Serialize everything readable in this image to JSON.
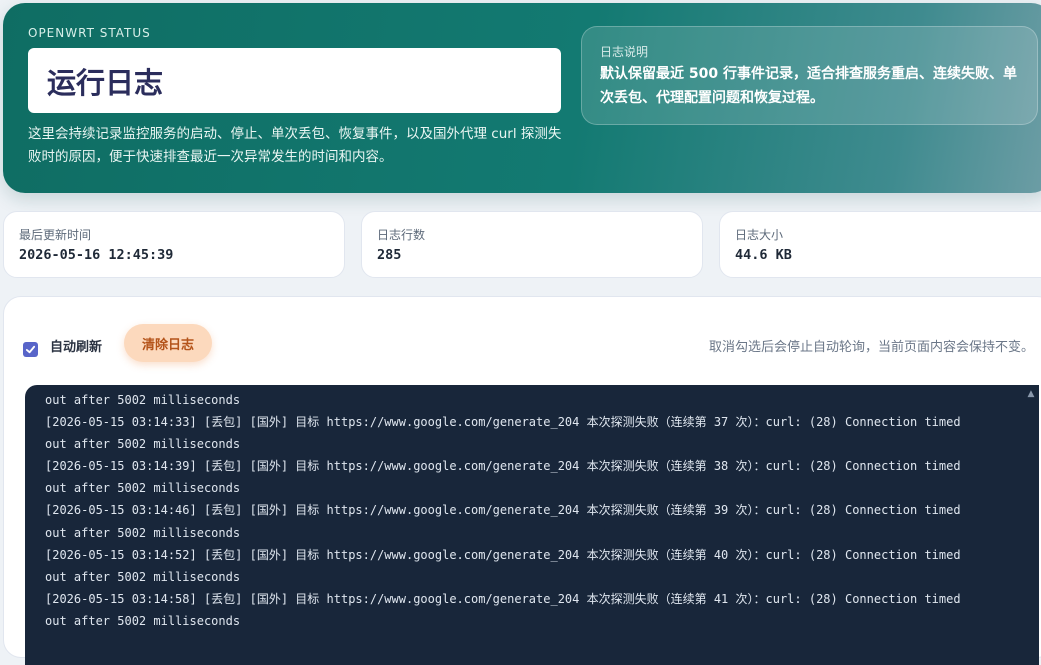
{
  "hero": {
    "eyebrow": "OPENWRT STATUS",
    "title": "运行日志",
    "description": "这里会持续记录监控服务的启动、停止、单次丢包、恢复事件，以及国外代理 curl 探测失败时的原因，便于快速排查最近一次异常发生的时间和内容。",
    "note_title": "日志说明",
    "note_body": "默认保留最近 500 行事件记录，适合排查服务重启、连续失败、单次丢包、代理配置问题和恢复过程。"
  },
  "stats": [
    {
      "label": "最后更新时间",
      "value": "2026-05-16 12:45:39"
    },
    {
      "label": "日志行数",
      "value": "285"
    },
    {
      "label": "日志大小",
      "value": "44.6 KB"
    }
  ],
  "controls": {
    "auto_refresh_label": "自动刷新",
    "auto_refresh_checked": true,
    "clear_button_label": "清除日志",
    "hint": "取消勾选后会停止自动轮询，当前页面内容会保持不变。"
  },
  "log_lines": [
    "out after 5002 milliseconds",
    "[2026-05-15 03:14:33] [丢包] [国外] 目标 https://www.google.com/generate_204 本次探测失败（连续第 37 次）：curl: (28) Connection timed",
    "out after 5002 milliseconds",
    "[2026-05-15 03:14:39] [丢包] [国外] 目标 https://www.google.com/generate_204 本次探测失败（连续第 38 次）：curl: (28) Connection timed",
    "out after 5002 milliseconds",
    "[2026-05-15 03:14:46] [丢包] [国外] 目标 https://www.google.com/generate_204 本次探测失败（连续第 39 次）：curl: (28) Connection timed",
    "out after 5002 milliseconds",
    "[2026-05-15 03:14:52] [丢包] [国外] 目标 https://www.google.com/generate_204 本次探测失败（连续第 40 次）：curl: (28) Connection timed",
    "out after 5002 milliseconds",
    "[2026-05-15 03:14:58] [丢包] [国外] 目标 https://www.google.com/generate_204 本次探测失败（连续第 41 次）：curl: (28) Connection timed",
    "out after 5002 milliseconds"
  ],
  "colors": {
    "hero_start": "#0f6d63",
    "log_background": "#18263a",
    "checkbox": "#5865c9",
    "clear_button": "#fcd9bd"
  }
}
